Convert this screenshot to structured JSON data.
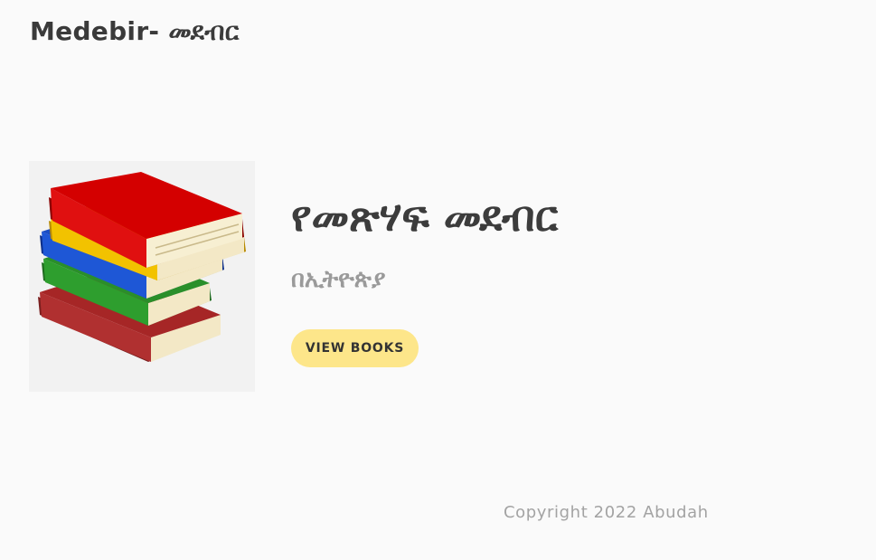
{
  "header": {
    "brand": "Medebir- መደብር"
  },
  "hero": {
    "image_icon": "stack-of-books-icon",
    "title": "የመጽሃፍ መደብር",
    "subtitle": "በኢትዮጵያ",
    "button_label": "VIEW BOOKS"
  },
  "footer": {
    "copyright": "Copyright 2022 Abudah"
  },
  "colors": {
    "background": "#fafafa",
    "button": "#fde68a",
    "title_text": "#3c3c3c",
    "subtitle_text": "#9a9a9a",
    "footer_text": "#a3a3a3"
  }
}
